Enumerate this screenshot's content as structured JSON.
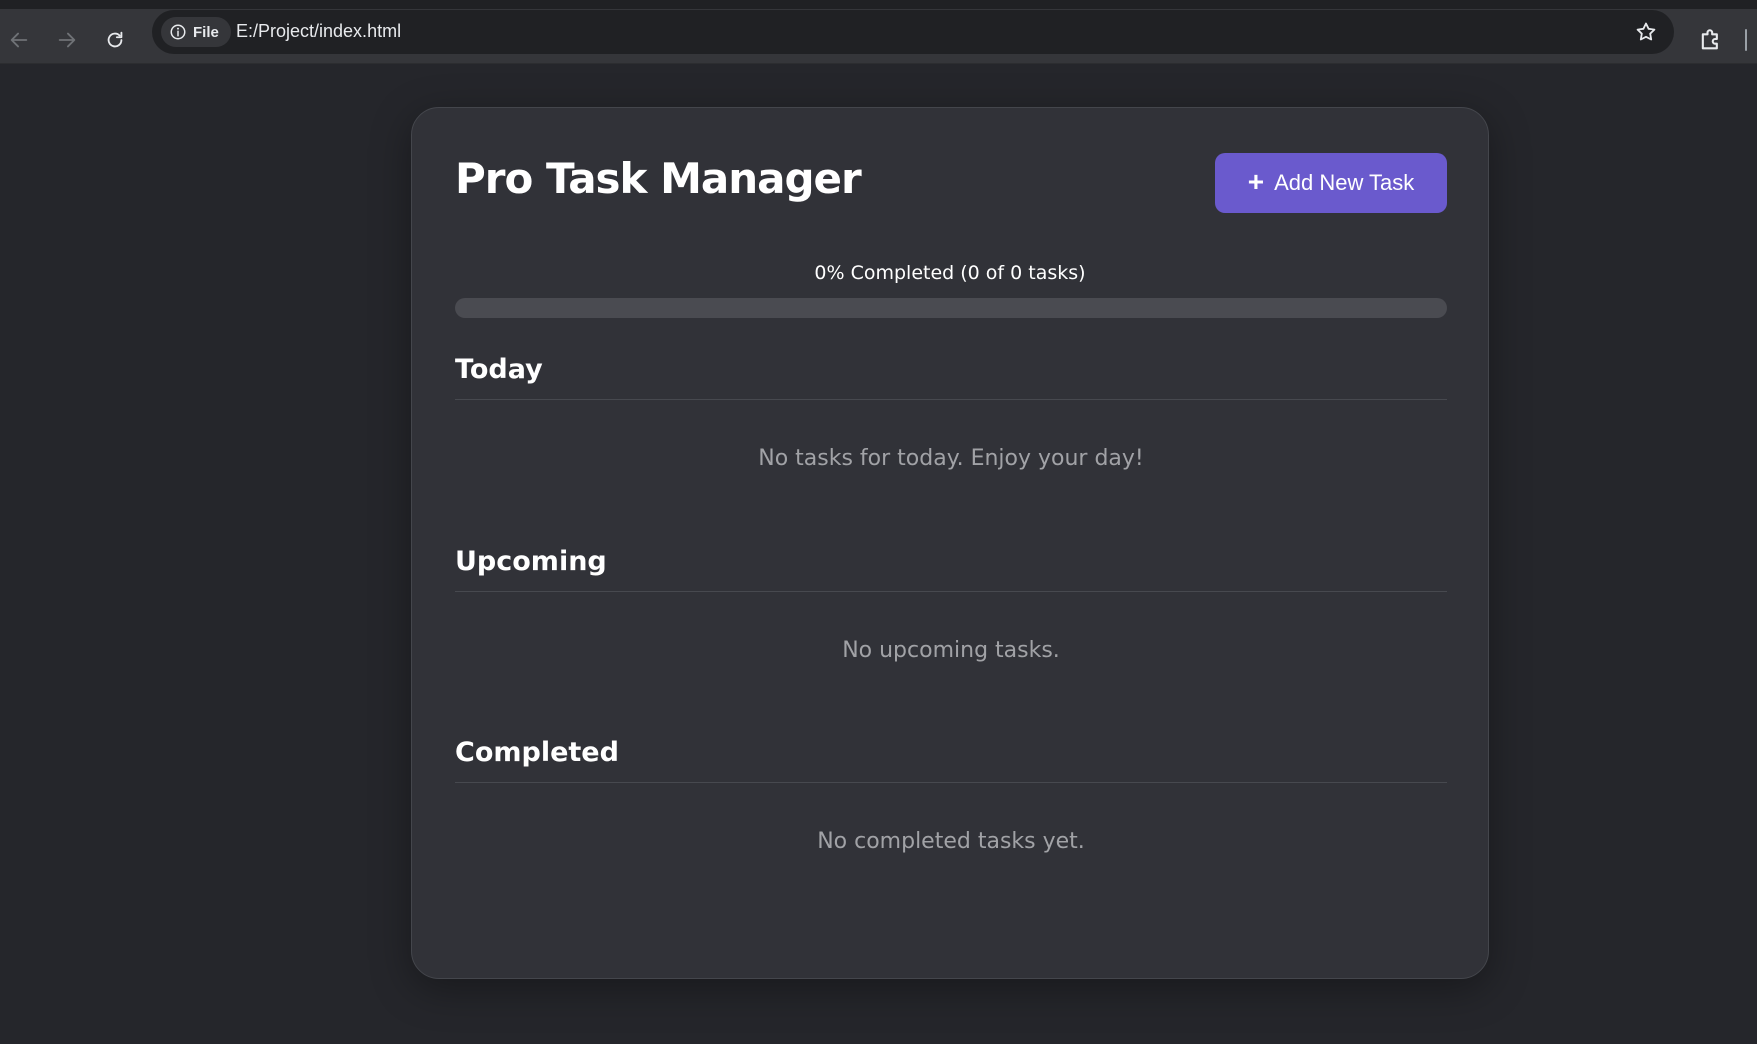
{
  "browser": {
    "site_chip_label": "File",
    "url": "E:/Project/index.html"
  },
  "app": {
    "title": "Pro Task Manager",
    "add_button_label": "Add New Task",
    "progress": {
      "label": "0% Completed (0 of 0 tasks)",
      "percent": 0
    },
    "sections": {
      "today": {
        "title": "Today",
        "empty_text": "No tasks for today. Enjoy your day!"
      },
      "upcoming": {
        "title": "Upcoming",
        "empty_text": "No upcoming tasks."
      },
      "completed": {
        "title": "Completed",
        "empty_text": "No completed tasks yet."
      }
    }
  },
  "colors": {
    "accent": "#6a5acd",
    "page_background": "#25262b",
    "card_background": "#313238"
  }
}
